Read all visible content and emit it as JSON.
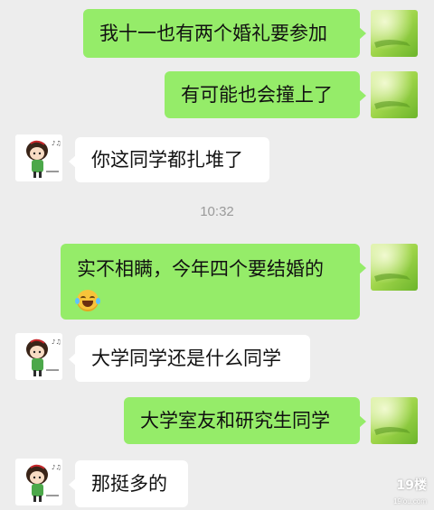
{
  "chat": {
    "timestamp": "10:32",
    "messages": [
      {
        "sender": "me",
        "text": "我十一也有两个婚礼要参加"
      },
      {
        "sender": "me",
        "text": "有可能也会撞上了"
      },
      {
        "sender": "other",
        "text": "你这同学都扎堆了"
      },
      {
        "sender": "me",
        "text": "实不相瞒，今年四个要结婚的",
        "emoji": "laughing-crying-emoji"
      },
      {
        "sender": "other",
        "text": "大学同学还是什么同学"
      },
      {
        "sender": "me",
        "text": "大学室友和研究生同学"
      },
      {
        "sender": "other",
        "text": "那挺多的"
      }
    ]
  },
  "avatars": {
    "me": "green-nature-avatar",
    "other": "cartoon-girl-avatar"
  },
  "watermark": {
    "main": "19楼",
    "sub": "19lou.com"
  }
}
